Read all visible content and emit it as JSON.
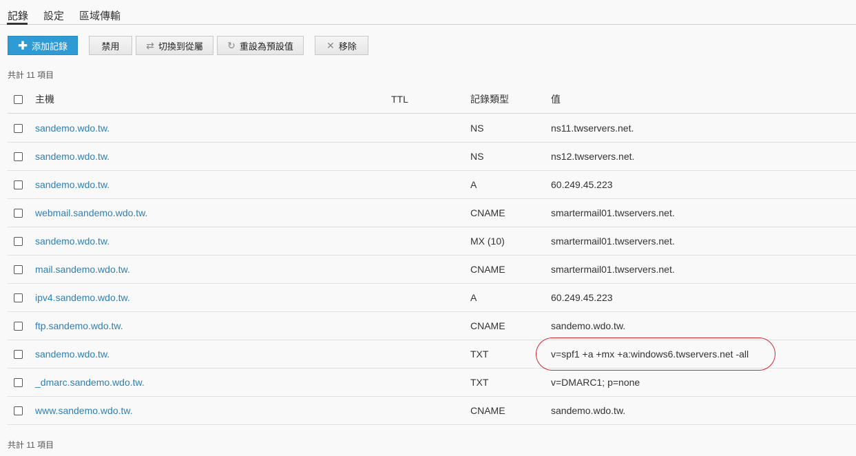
{
  "tabs": [
    {
      "label": "記錄",
      "active": true
    },
    {
      "label": "設定",
      "active": false
    },
    {
      "label": "區域傳輸",
      "active": false
    }
  ],
  "toolbar": {
    "add_label": "添加記錄",
    "disable_label": "禁用",
    "switch_label": "切換到從屬",
    "reset_label": "重設為預設值",
    "remove_label": "移除"
  },
  "summary": {
    "top": "共計 11 項目",
    "bottom": "共計 11 項目"
  },
  "table": {
    "headers": {
      "host": "主機",
      "ttl": "TTL",
      "type": "記錄類型",
      "value": "值"
    },
    "rows": [
      {
        "host": "sandemo.wdo.tw.",
        "ttl": "",
        "type": "NS",
        "value": "ns11.twservers.net."
      },
      {
        "host": "sandemo.wdo.tw.",
        "ttl": "",
        "type": "NS",
        "value": "ns12.twservers.net."
      },
      {
        "host": "sandemo.wdo.tw.",
        "ttl": "",
        "type": "A",
        "value": "60.249.45.223"
      },
      {
        "host": "webmail.sandemo.wdo.tw.",
        "ttl": "",
        "type": "CNAME",
        "value": "smartermail01.twservers.net."
      },
      {
        "host": "sandemo.wdo.tw.",
        "ttl": "",
        "type": "MX (10)",
        "value": "smartermail01.twservers.net."
      },
      {
        "host": "mail.sandemo.wdo.tw.",
        "ttl": "",
        "type": "CNAME",
        "value": "smartermail01.twservers.net."
      },
      {
        "host": "ipv4.sandemo.wdo.tw.",
        "ttl": "",
        "type": "A",
        "value": "60.249.45.223"
      },
      {
        "host": "ftp.sandemo.wdo.tw.",
        "ttl": "",
        "type": "CNAME",
        "value": "sandemo.wdo.tw."
      },
      {
        "host": "sandemo.wdo.tw.",
        "ttl": "",
        "type": "TXT",
        "value": "v=spf1 +a +mx +a:windows6.twservers.net -all"
      },
      {
        "host": "_dmarc.sandemo.wdo.tw.",
        "ttl": "",
        "type": "TXT",
        "value": "v=DMARC1; p=none"
      },
      {
        "host": "www.sandemo.wdo.tw.",
        "ttl": "",
        "type": "CNAME",
        "value": "sandemo.wdo.tw."
      }
    ]
  },
  "colors": {
    "accent": "#2f9bd5",
    "link": "#2f7fb3",
    "highlight": "#d6262b"
  },
  "icons": {
    "add": "plus-icon",
    "switch": "switch-icon",
    "reset": "reset-icon",
    "remove": "close-icon"
  }
}
